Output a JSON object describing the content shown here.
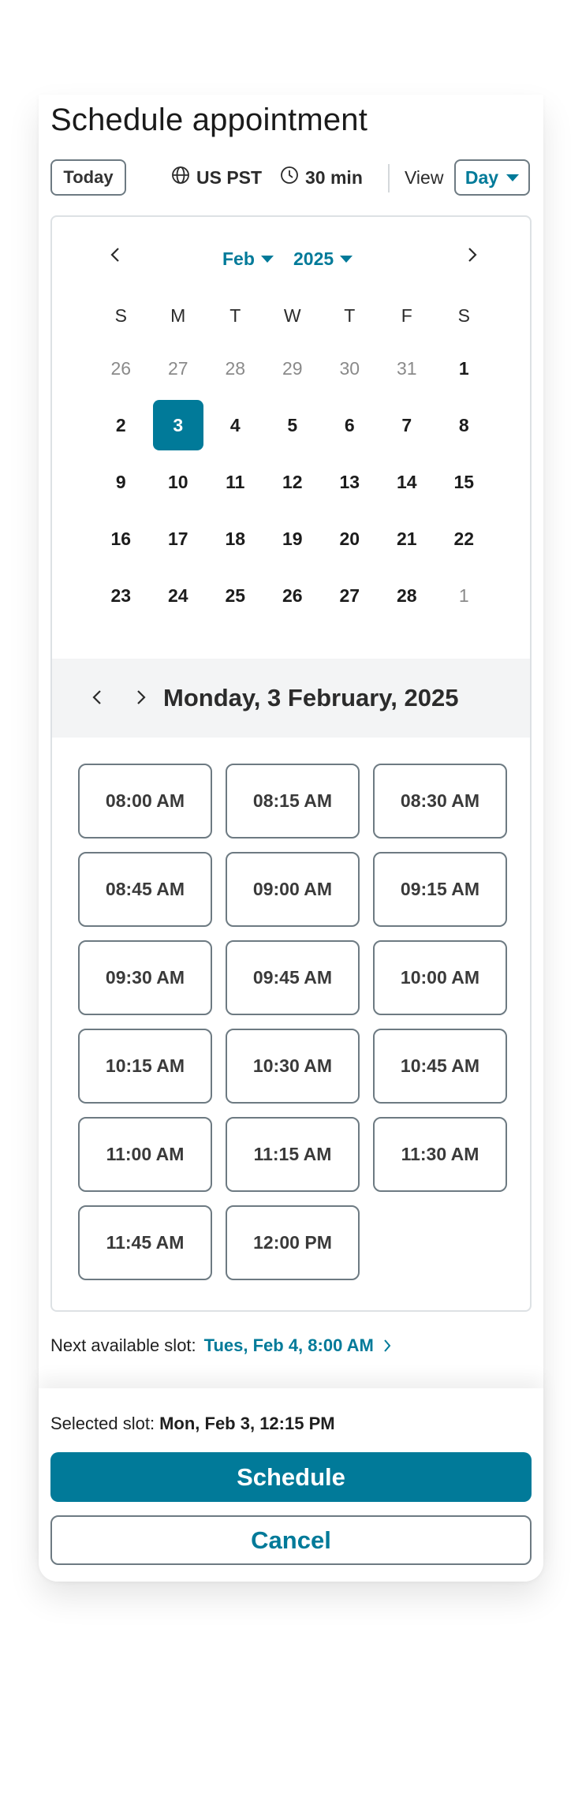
{
  "title": "Schedule appointment",
  "toolbar": {
    "today_label": "Today",
    "timezone": "US PST",
    "duration": "30 min",
    "view_label": "View",
    "view_value": "Day"
  },
  "calendar": {
    "month": "Feb",
    "year": "2025",
    "weekdays": [
      "S",
      "M",
      "T",
      "W",
      "T",
      "F",
      "S"
    ],
    "days": [
      {
        "label": "26",
        "muted": true
      },
      {
        "label": "27",
        "muted": true
      },
      {
        "label": "28",
        "muted": true
      },
      {
        "label": "29",
        "muted": true
      },
      {
        "label": "30",
        "muted": true
      },
      {
        "label": "31",
        "muted": true
      },
      {
        "label": "1"
      },
      {
        "label": "2"
      },
      {
        "label": "3",
        "selected": true
      },
      {
        "label": "4"
      },
      {
        "label": "5"
      },
      {
        "label": "6"
      },
      {
        "label": "7"
      },
      {
        "label": "8"
      },
      {
        "label": "9"
      },
      {
        "label": "10"
      },
      {
        "label": "11"
      },
      {
        "label": "12"
      },
      {
        "label": "13"
      },
      {
        "label": "14"
      },
      {
        "label": "15"
      },
      {
        "label": "16"
      },
      {
        "label": "17"
      },
      {
        "label": "18"
      },
      {
        "label": "19"
      },
      {
        "label": "20"
      },
      {
        "label": "21"
      },
      {
        "label": "22"
      },
      {
        "label": "23"
      },
      {
        "label": "24"
      },
      {
        "label": "25"
      },
      {
        "label": "26"
      },
      {
        "label": "27"
      },
      {
        "label": "28"
      },
      {
        "label": "1",
        "muted": true
      }
    ]
  },
  "date_header": "Monday, 3 February, 2025",
  "slots": [
    "08:00 AM",
    "08:15 AM",
    "08:30 AM",
    "08:45 AM",
    "09:00 AM",
    "09:15 AM",
    "09:30 AM",
    "09:45 AM",
    "10:00 AM",
    "10:15 AM",
    "10:30 AM",
    "10:45 AM",
    "11:00 AM",
    "11:15 AM",
    "11:30 AM",
    "11:45 AM",
    "12:00 PM"
  ],
  "next_available": {
    "label": "Next available slot:",
    "value": "Tues, Feb 4, 8:00 AM"
  },
  "selected_slot": {
    "label": "Selected slot:",
    "value": "Mon, Feb 3, 12:15 PM"
  },
  "actions": {
    "schedule": "Schedule",
    "cancel": "Cancel"
  },
  "colors": {
    "accent": "#017a99",
    "border": "#6d7a82",
    "date_bar_bg": "#f3f4f5"
  }
}
